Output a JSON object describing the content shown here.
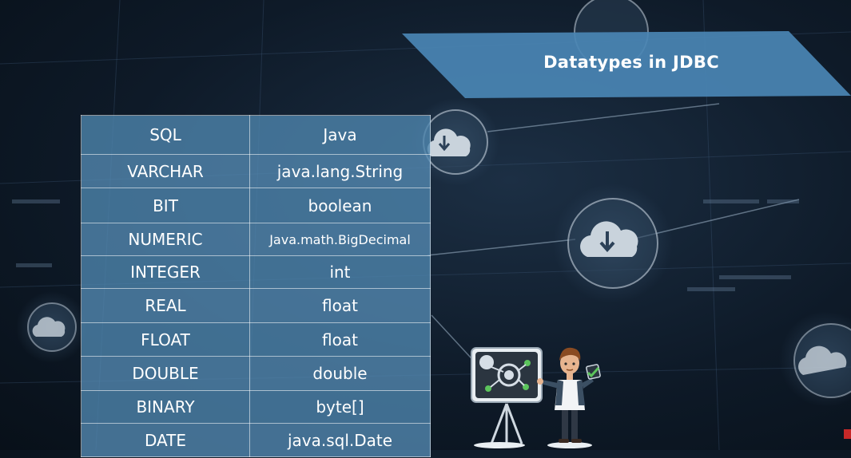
{
  "slide": {
    "title": "Datatypes in JDBC"
  },
  "table": {
    "headers": [
      "SQL",
      "Java"
    ],
    "rows": [
      [
        "VARCHAR",
        "java.lang.String"
      ],
      [
        "BIT",
        "boolean"
      ],
      [
        "NUMERIC",
        "Java.math.BigDecimal"
      ],
      [
        "INTEGER",
        "int"
      ],
      [
        "REAL",
        "float"
      ],
      [
        "FLOAT",
        "float"
      ],
      [
        "DOUBLE",
        "double"
      ],
      [
        "BINARY",
        "byte[]"
      ],
      [
        "DATE",
        "java.sql.Date"
      ]
    ]
  },
  "colors": {
    "banner": "#4a86b4",
    "table_cell": "#548bb4",
    "background": "#0e1a28"
  },
  "icons": [
    "cloud-download-icon",
    "cloud-upload-icon",
    "presenter-illustration",
    "whiteboard-icon",
    "checkmark-icon"
  ]
}
